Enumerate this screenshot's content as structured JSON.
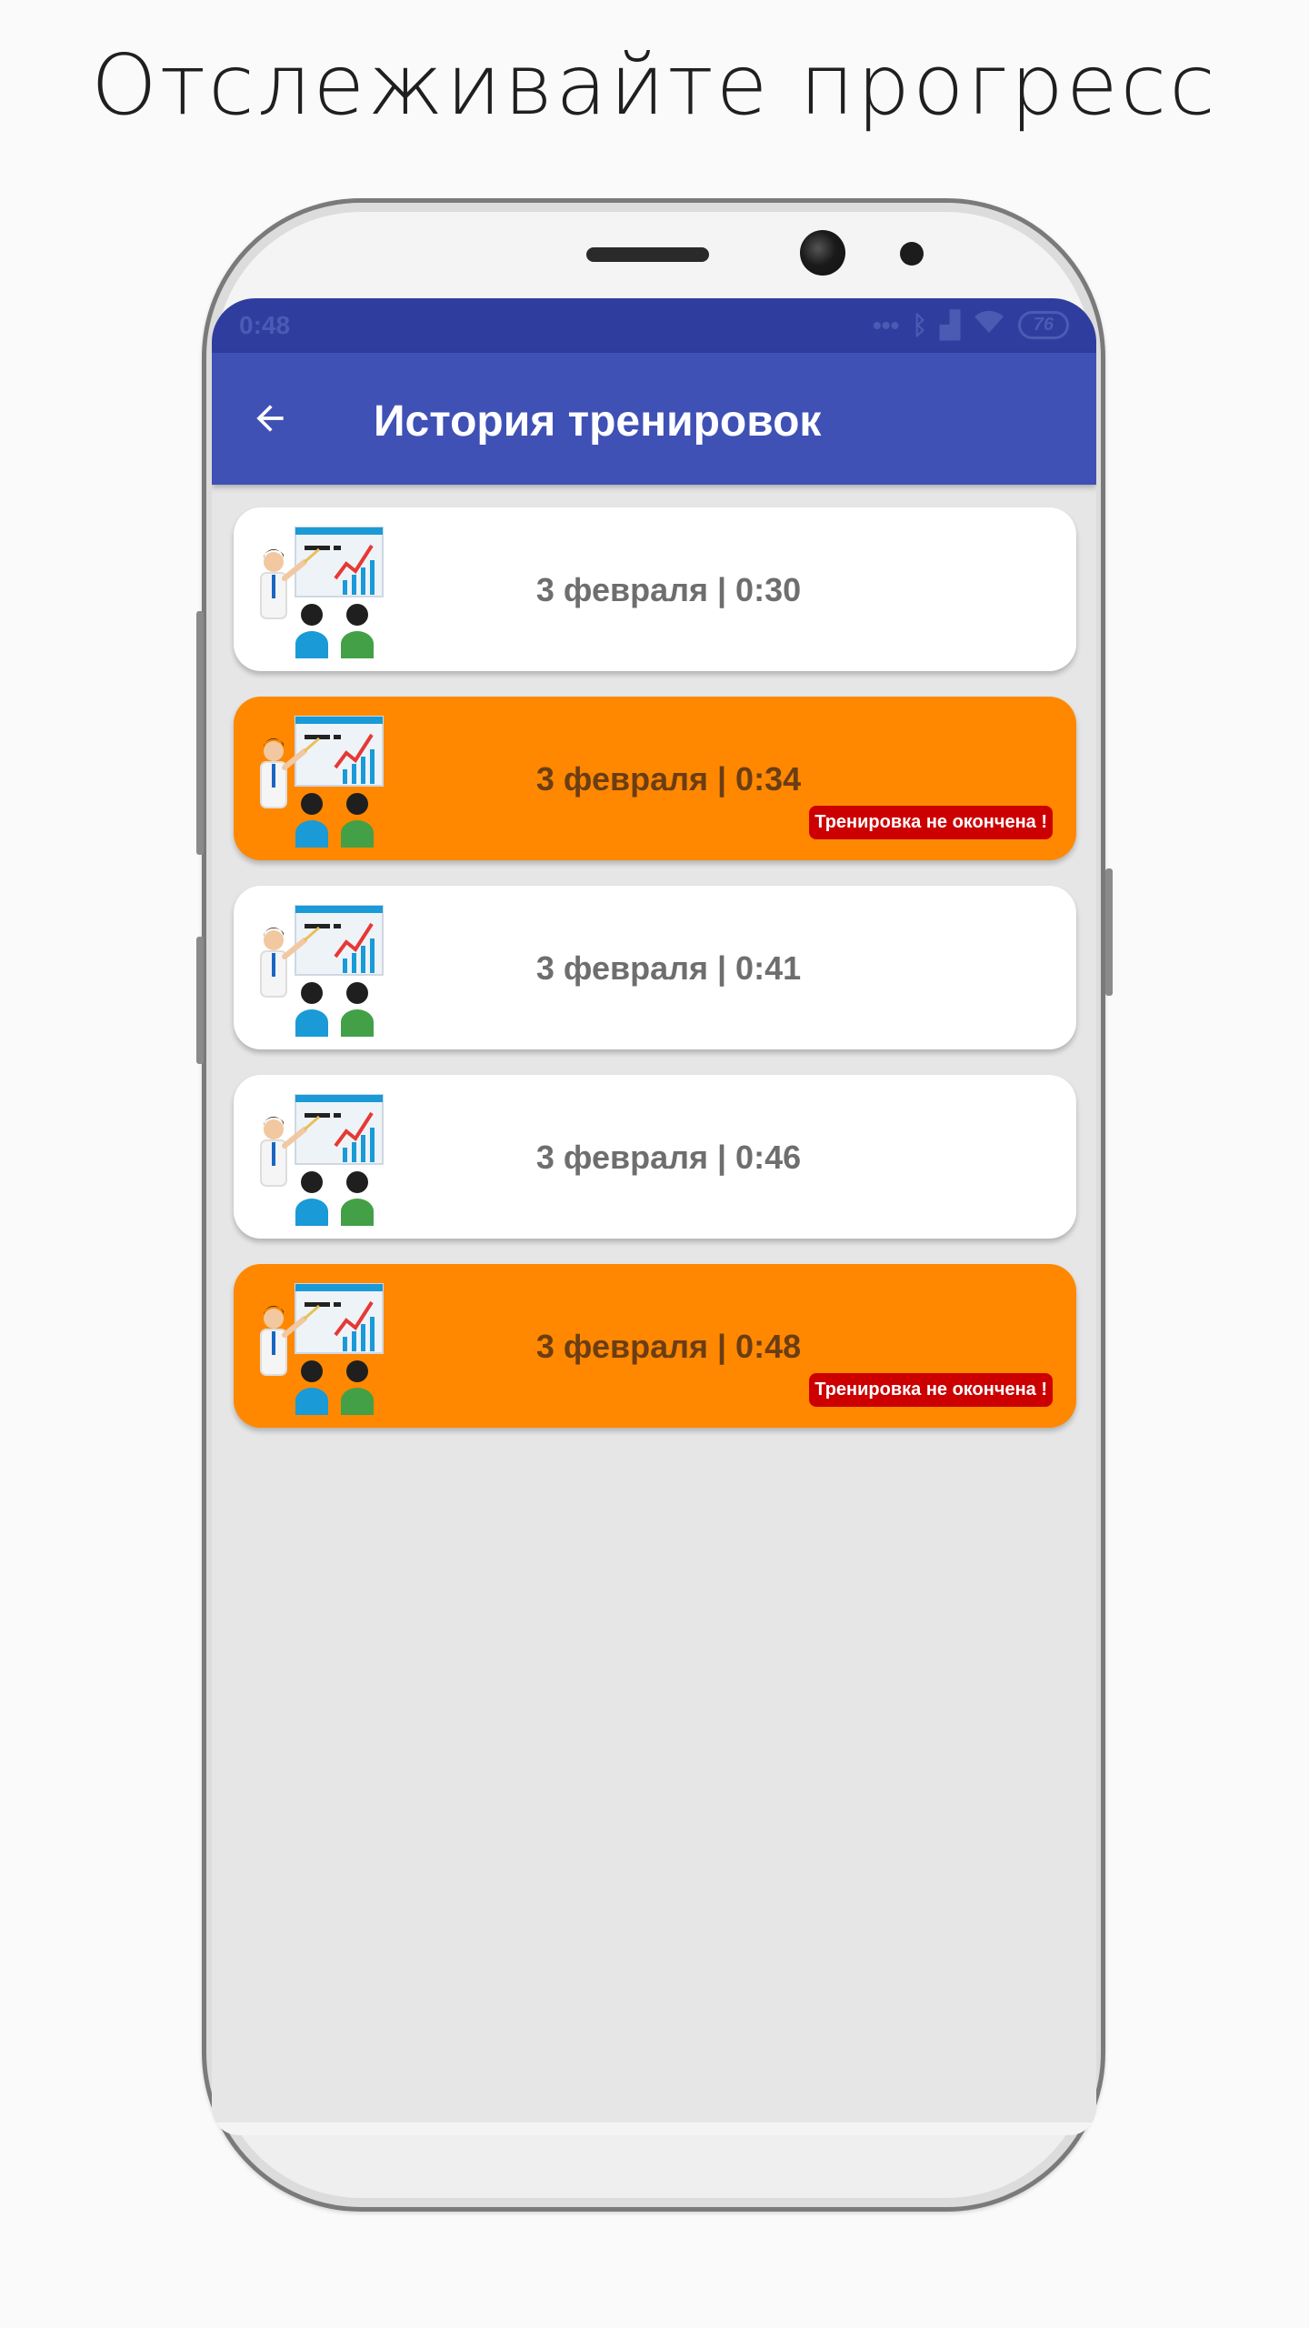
{
  "promo": {
    "title": "Отслеживайте прогресс"
  },
  "statusbar": {
    "time": "0:48",
    "battery": "76"
  },
  "appbar": {
    "title": "История тренировок"
  },
  "colors": {
    "appbar": "#3f51b5",
    "statusbar": "#2f3e9e",
    "unfinished": "#ff8800",
    "badge": "#cc0000"
  },
  "workouts": [
    {
      "label": "3 февраля | 0:30",
      "status": "done",
      "badge": ""
    },
    {
      "label": "3 февраля | 0:34",
      "status": "unfinished",
      "badge": "Тренировка не окончена !"
    },
    {
      "label": "3 февраля | 0:41",
      "status": "done",
      "badge": ""
    },
    {
      "label": "3 февраля | 0:46",
      "status": "done",
      "badge": ""
    },
    {
      "label": "3 февраля | 0:48",
      "status": "unfinished",
      "badge": "Тренировка не окончена !"
    }
  ]
}
